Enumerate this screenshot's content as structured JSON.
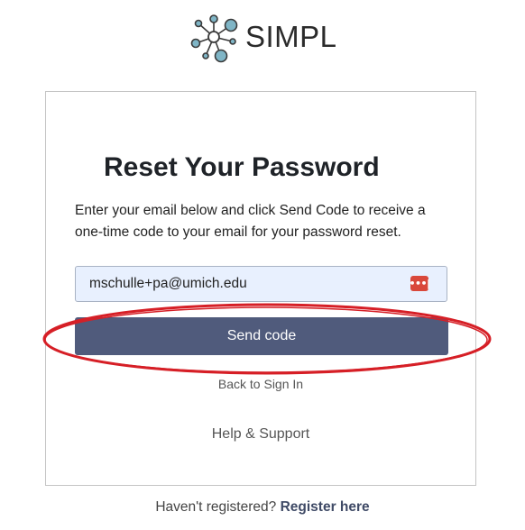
{
  "brand": {
    "name": "SIMPL",
    "icon": "molecule-network-icon"
  },
  "card": {
    "title": "Reset Your Password",
    "description": "Enter your email below and click Send Code to receive a one-time code to your email for your password reset.",
    "email": {
      "value": "mschulle+pa@umich.edu",
      "autofill_icon": "password-manager-icon"
    },
    "send_button": "Send code",
    "back_link": "Back to Sign In",
    "help_link": "Help & Support"
  },
  "footer": {
    "prompt": "Haven't registered?",
    "register_link": "Register here"
  },
  "colors": {
    "primary_button": "#505b7c",
    "input_background": "#e8f0fe",
    "annotation": "#d61f26",
    "logo_node": "#7fb5c6"
  }
}
